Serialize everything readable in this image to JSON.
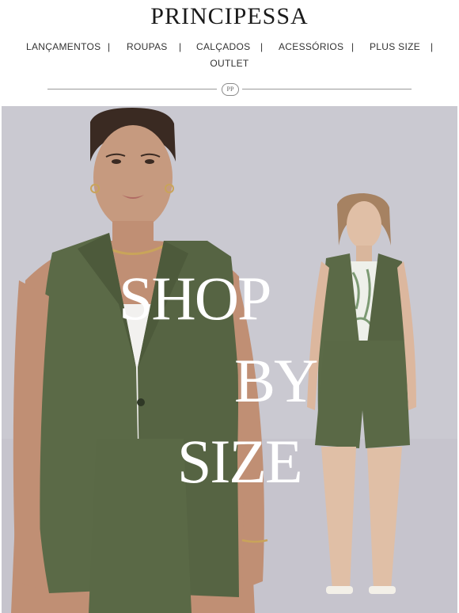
{
  "brand": {
    "logo": "PRINCIPESSA",
    "monogram": "PP"
  },
  "nav": {
    "items": [
      "LANÇAMENTOS",
      "ROUPAS",
      "CALÇADOS",
      "ACESSÓRIOS",
      "PLUS SIZE",
      "OUTLET"
    ],
    "separator": "|"
  },
  "hero": {
    "line1": "SHOP",
    "line2": "BY",
    "line3": "SIZE"
  },
  "colors": {
    "hero_background": "#c9c8d0",
    "garment_green": "#5b6a47",
    "text_white": "#ffffff"
  }
}
